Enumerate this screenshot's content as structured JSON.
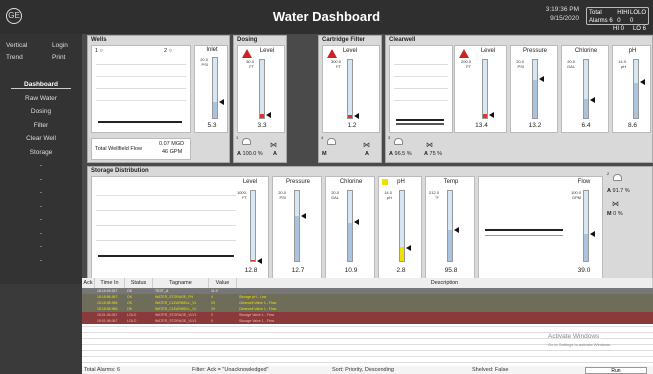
{
  "app": {
    "title": "Water Dashboard",
    "logo": "GE",
    "time": "3:19:36 PM",
    "date": "9/15/2020"
  },
  "alarms": {
    "total_label": "Total Alarms",
    "total": "6",
    "hihi_label": "HIHI",
    "hihi": "0",
    "hi_label": "HI",
    "hi": "0",
    "lolo_label": "LOLO",
    "lolo": "0",
    "lo_label": "LO",
    "lo": "6"
  },
  "sidebar": {
    "top": [
      "Vertical",
      "Login",
      "Trend",
      "Print"
    ],
    "nav": [
      "Dashboard",
      "Raw Water",
      "Dosing",
      "Filter",
      "Clear Well",
      "Storage",
      "-",
      "-",
      "-",
      "-",
      "-",
      "-",
      "-",
      "-"
    ]
  },
  "wells": {
    "title": "Wells",
    "well1": "1",
    "well2": "2",
    "inlet_label": "Inlet",
    "inlet_unit": "20.0\nPSI",
    "inlet_value": "5.3",
    "inlet_fraction": 0.27,
    "flow_label": "Total Wellfield Flow",
    "flow_mgd": "0.07 MGD",
    "flow_gpm": "46 GPM"
  },
  "dosing": {
    "title": "Dosing",
    "level_label": "Level",
    "unit": "50.0\nFT",
    "value": "3.3",
    "fraction": 0.07,
    "pump_num": "1",
    "pump_mode": "A",
    "pump_pct": "100.0 %",
    "valve_mode": "A"
  },
  "cartridge": {
    "title": "Cartridge Filter",
    "level_label": "Level",
    "unit": "300.0\nFT",
    "value": "1.2",
    "fraction": 0.05,
    "pump_num": "4",
    "pump_mode": "M",
    "valve_mode": "A"
  },
  "clearwell": {
    "title": "Clearwell",
    "level_label": "Level",
    "level_unit": "200.0\nFT",
    "level_value": "13.4",
    "level_fraction": 0.07,
    "pressure_label": "Pressure",
    "pressure_unit": "20.0\nPSI",
    "pressure_value": "13.2",
    "pressure_fraction": 0.66,
    "chlorine_label": "Chlorine",
    "chlorine_unit": "20.0\nGAL",
    "chlorine_value": "6.4",
    "chlorine_fraction": 0.32,
    "ph_label": "pH",
    "ph_unit": "14.0\npH",
    "ph_value": "8.6",
    "ph_fraction": 0.61,
    "pump_num": "3",
    "pump_mode": "A",
    "pump_pct": "96.5 %",
    "valve_mode": "A",
    "valve_pct": "75 %"
  },
  "storage": {
    "title": "Storage Distribution",
    "level_label": "Level",
    "level_unit": "1000.\nFT",
    "level_value": "12.8",
    "level_fraction": 0.013,
    "pressure_label": "Pressure",
    "pressure_unit": "20.0\nPSI",
    "pressure_value": "12.7",
    "pressure_fraction": 0.64,
    "chlorine_label": "Chlorine",
    "chlorine_unit": "20.0\nGAL",
    "chlorine_value": "10.9",
    "chlorine_fraction": 0.55,
    "ph_label": "pH",
    "ph_unit": "14.0\npH",
    "ph_value": "2.8",
    "ph_fraction": 0.2,
    "temp_label": "Temp",
    "temp_unit": "212.0\n°F",
    "temp_value": "95.8",
    "temp_fraction": 0.45,
    "flow_label": "Flow",
    "flow_unit": "100.0\nGPM",
    "flow_value": "39.0",
    "flow_fraction": 0.39,
    "pump_num": "2",
    "pump_mode": "A",
    "pump_pct": "91.7 %",
    "valve_mode": "M",
    "valve_pct": "0 %"
  },
  "table": {
    "headers": [
      "Ack",
      "Time In",
      "Status",
      "Tagname",
      "Value",
      "Description"
    ],
    "rows": [
      {
        "ack": "",
        "time": "15:19:03.917",
        "status": "OK",
        "tag": "TEST_A",
        "value": "11.9",
        "desc": ""
      },
      {
        "ack": "",
        "time": "15:18:56.957",
        "status": "OK",
        "tag": "WATER_STORAGE_PH",
        "value": "4",
        "desc": "Storage pH - Low"
      },
      {
        "ack": "",
        "time": "15:18:58.956",
        "status": "OK",
        "tag": "WATER_CLEARWELL_VL",
        "value": "29",
        "desc": "Clearwell Valve 1 - Flow"
      },
      {
        "ack": "",
        "time": "15:18:58.956",
        "status": "OK",
        "tag": "WATER_CLEARWELL_VL",
        "value": "29",
        "desc": "Clearwell Valve 1 - Flow"
      },
      {
        "ack": "",
        "time": "15:01:06.067",
        "status": "LOLO",
        "tag": "WATER_STORAGE_VLV1",
        "value": "0",
        "desc": "Storage Valve 1 - Flow"
      },
      {
        "ack": "",
        "time": "15:01:06.067",
        "status": "LOLO",
        "tag": "WATER_STORAGE_VLV1",
        "value": "0",
        "desc": "Storage Valve 1 - Flow"
      }
    ]
  },
  "footer": {
    "total": "Total Alarms: 6",
    "filter": "Filter: Ack = \"Unacknowledged\"",
    "sort": "Sort: Priority, Descending",
    "shelved": "Shelved: False",
    "run": "Run"
  },
  "watermark": {
    "title": "Activate Windows",
    "sub": "Go to Settings to activate Windows."
  },
  "colors": {
    "accent_red": "#c22",
    "bar_fill_red": "#d33",
    "bar_fill_yellow": "#f0e000"
  }
}
